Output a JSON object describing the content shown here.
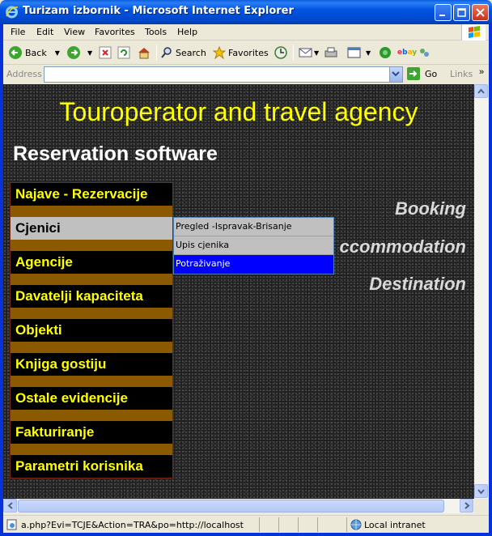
{
  "window": {
    "title": "Turizam izbornik - Microsoft Internet Explorer"
  },
  "menubar": {
    "items": [
      "File",
      "Edit",
      "View",
      "Favorites",
      "Tools",
      "Help"
    ]
  },
  "toolbar": {
    "back_label": "Back",
    "search_label": "Search",
    "favorites_label": "Favorites"
  },
  "addressbar": {
    "label": "Address",
    "value": "",
    "go_label": "Go",
    "links_label": "Links"
  },
  "page": {
    "headline": "Touroperator and travel agency",
    "subheadline": "Reservation software",
    "nav": [
      {
        "label": "Najave - Rezervacije",
        "active": false
      },
      {
        "label": "Cjenici",
        "active": true
      },
      {
        "label": "Agencije",
        "active": false
      },
      {
        "label": "Davatelji kapaciteta",
        "active": false
      },
      {
        "label": "Objekti",
        "active": false
      },
      {
        "label": "Knjiga gostiju",
        "active": false
      },
      {
        "label": "Ostale evidencije",
        "active": false
      },
      {
        "label": "Fakturiranje",
        "active": false
      },
      {
        "label": "Parametri korisnika",
        "active": false
      }
    ],
    "submenu": [
      {
        "label": "Pregled -Ispravak-Brisanje",
        "highlighted": false
      },
      {
        "label": "Upis cjenika",
        "highlighted": false
      },
      {
        "label": "Potraživanje",
        "highlighted": true
      }
    ],
    "right_words": [
      "Booking",
      "ccommodation",
      "Destination"
    ]
  },
  "statusbar": {
    "text": "a.php?Evi=TCJE&Action=TRA&po=http://localhost",
    "zone": "Local intranet"
  },
  "colors": {
    "headline": "#ffff00",
    "nav_text": "#ffff00",
    "nav_active_bg": "#c0c0c0",
    "submenu_highlight": "#0000ff",
    "nav_separator": "#8b5a00"
  }
}
